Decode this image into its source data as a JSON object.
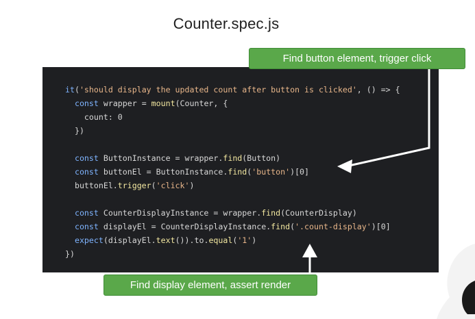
{
  "slide": {
    "title": "Counter.spec.js"
  },
  "code": {
    "lines": [
      "it('should display the updated count after button is clicked', () => {",
      "  const wrapper = mount(Counter, {",
      "    count: 0",
      "  })",
      "",
      "  const ButtonInstance = wrapper.find(Button)",
      "  const buttonEl = ButtonInstance.find('button')[0]",
      "  buttonEl.trigger('click')",
      "",
      "  const CounterDisplayInstance = wrapper.find(CounterDisplay)",
      "  const displayEl = CounterDisplayInstance.find('.count-display')[0]",
      "  expect(displayEl.text()).to.equal('1')",
      "})"
    ]
  },
  "callouts": {
    "top": "Find button element, trigger click",
    "bottom": "Find display element, assert render"
  },
  "colors": {
    "panel_bg": "#1e1f22",
    "callout_bg": "#5aa84a",
    "keyword": "#7fb4ff",
    "string": "#e8b68a",
    "function": "#f2e7a0",
    "number": "#a6e3a1"
  }
}
